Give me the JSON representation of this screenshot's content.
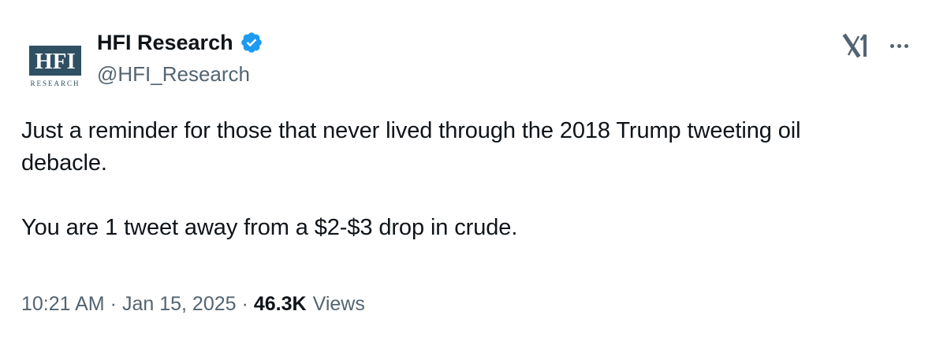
{
  "author": {
    "display_name": "HFI Research",
    "handle": "@HFI_Research",
    "avatar": {
      "logo_text": "HFI",
      "logo_subtext": "RESEARCH",
      "color": "#2f4f63"
    },
    "verified_icon": "verified-badge-icon",
    "verified_color": "#1d9bf0"
  },
  "actions": {
    "brand_icon": "x-logo-icon",
    "more_icon": "more-icon"
  },
  "tweet": {
    "paragraphs": [
      "Just a reminder for those that never lived through the 2018 Trump tweeting oil debacle.",
      "You are 1 tweet away from a $2-$3 drop in crude."
    ]
  },
  "meta": {
    "time": "10:21 AM",
    "separator": "·",
    "date": "Jan 15, 2025",
    "views_count": "46.3K",
    "views_label": "Views"
  },
  "colors": {
    "text_primary": "#0f1419",
    "text_secondary": "#536471",
    "background": "#ffffff"
  }
}
